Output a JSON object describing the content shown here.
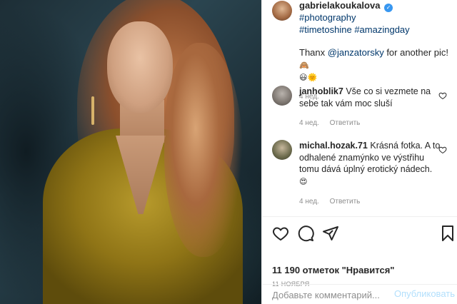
{
  "post": {
    "username": "gabrielakoukalova",
    "hashtags_line1": "#photography",
    "hashtags_line2": "#timetoshine #amazingday",
    "thanks_prefix": "Thanx ",
    "thanks_mention": "@janzatorsky",
    "thanks_suffix": " for another pic!",
    "emoji_line1": "🙈",
    "emoji_line2": "😃🌞",
    "age": "4 нед."
  },
  "comments": [
    {
      "username": "janhoblik7",
      "text": "Vše co si vezmete na sebe tak vám moc sluší",
      "age": "4 нед.",
      "reply_label": "Ответить"
    },
    {
      "username": "michal.hozak.71",
      "text": "Krásná fotka. A to odhalené znamýnko ve výstřihu tomu dává úplný erotický nádech.",
      "emoji": "😍",
      "age": "4 нед.",
      "reply_label": "Ответить"
    }
  ],
  "likes_text": "11 190 отметок \"Нравится\"",
  "date_text": "11 НОЯБРЯ",
  "add_comment": {
    "placeholder": "Добавьте комментарий...",
    "publish_label": "Опубликовать"
  },
  "icons": {
    "verified": "verified-badge",
    "like": "heart-icon",
    "comment": "comment-icon",
    "share": "paper-plane-icon",
    "save": "bookmark-icon"
  },
  "colors": {
    "link": "#00376b",
    "verified": "#3897f0",
    "muted": "#8e8e8e",
    "publish_disabled": "#b2dffc"
  }
}
